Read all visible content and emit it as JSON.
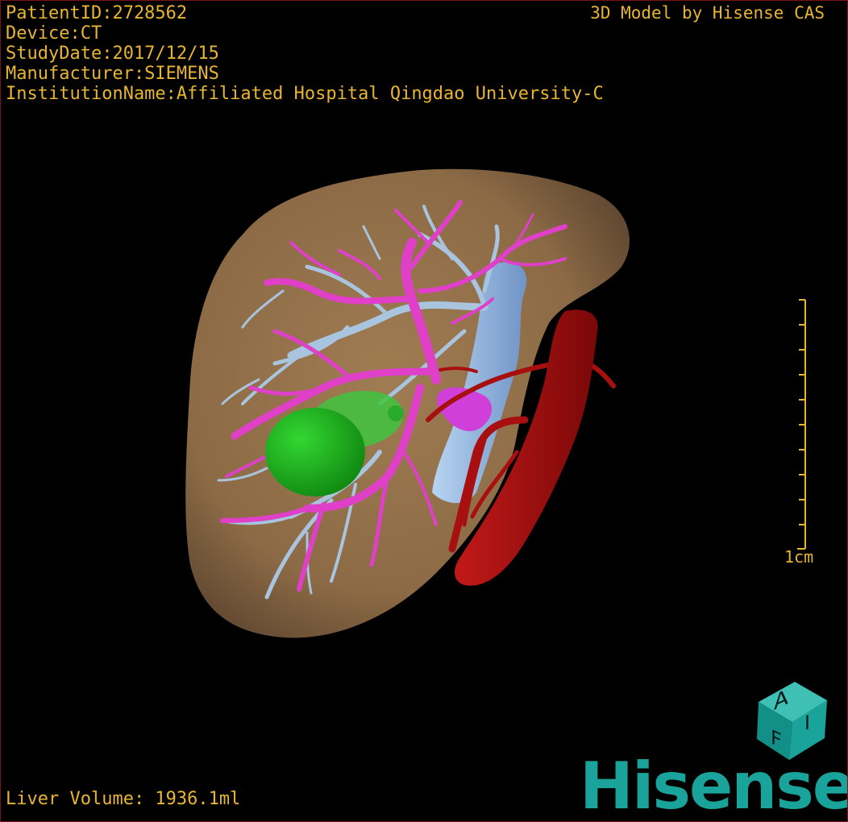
{
  "info": {
    "patient_id": "PatientID:2728562",
    "device": "Device:CT",
    "study_date": "StudyDate:2017/12/15",
    "manufacturer": "Manufacturer:SIEMENS",
    "institution": "InstitutionName:Affiliated Hospital Qingdao University-C"
  },
  "brand_text": "3D Model by Hisense CAS",
  "volume_text": "Liver Volume: 1936.1ml",
  "scale": {
    "label": "1cm",
    "ticks": 11
  },
  "logo": {
    "cube_letters": [
      "A",
      "I",
      "F"
    ],
    "wordmark": "Hisense",
    "color": "#1aa39a"
  },
  "colors": {
    "text": "#e8b530",
    "liver": "#8b6a45",
    "portal_vein": "#e040c8",
    "hepatic_vein": "#a8c4de",
    "ivc": "#9cc0e8",
    "artery_aorta": "#a80f0f",
    "tumor": "#22b822",
    "portal_confluence": "#d040d8"
  }
}
